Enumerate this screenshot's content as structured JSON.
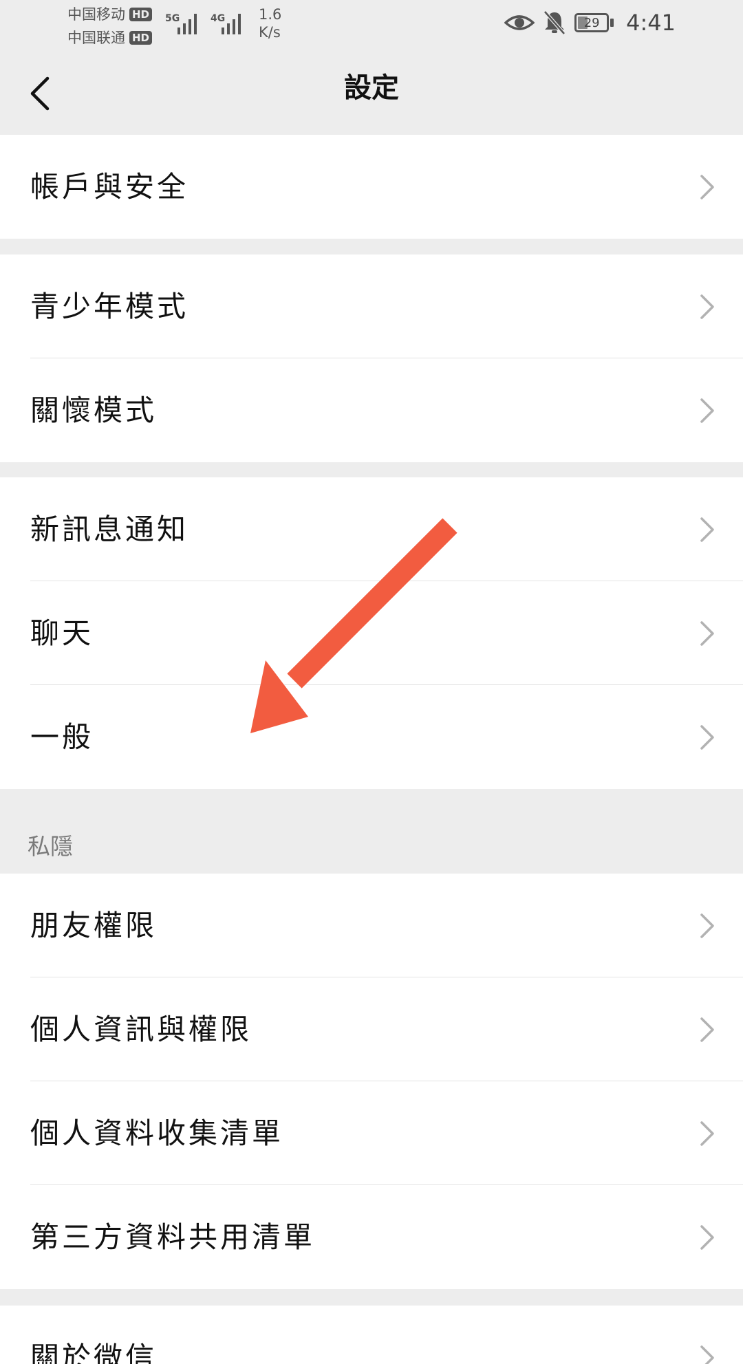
{
  "status_bar": {
    "carrier_1": "中国移动",
    "carrier_2": "中国联通",
    "hd_badge": "HD",
    "net_1": "5G",
    "net_2": "4G",
    "speed_value": "1.6",
    "speed_unit": "K/s",
    "battery_level": "29",
    "time": "4:41"
  },
  "nav": {
    "title": "設定",
    "back_icon": "chevron-left-icon"
  },
  "groups": [
    {
      "items": [
        "帳戶與安全"
      ]
    },
    {
      "items": [
        "青少年模式",
        "關懷模式"
      ]
    },
    {
      "items": [
        "新訊息通知",
        "聊天",
        "一般"
      ]
    },
    {
      "header": "私隱",
      "items": [
        "朋友權限",
        "個人資訊與權限",
        "個人資料收集清單",
        "第三方資料共用清單"
      ]
    },
    {
      "items": [
        "關於微信"
      ]
    }
  ],
  "annotation": {
    "icon": "arrow-icon",
    "color": "#f25c40",
    "points_to": "一般"
  },
  "colors": {
    "background": "#ededed",
    "card": "#ffffff",
    "text": "#111111",
    "chevron": "#b2b2b2"
  }
}
